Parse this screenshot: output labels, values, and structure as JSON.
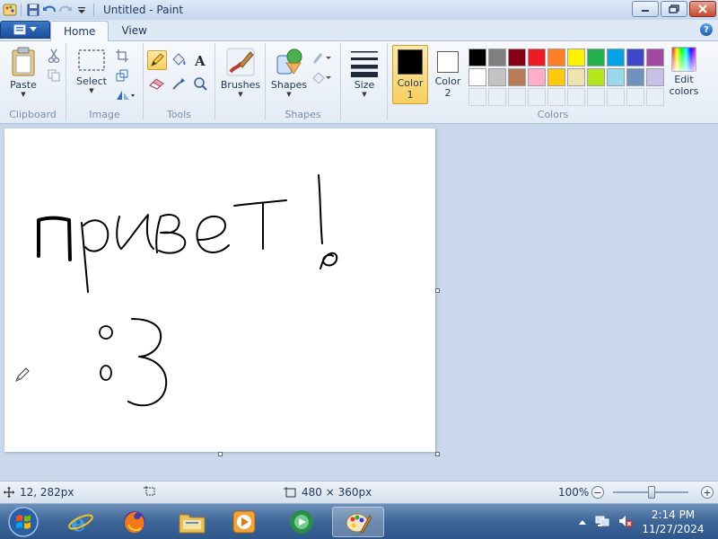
{
  "window": {
    "title": "Untitled - Paint"
  },
  "tabs": {
    "home": "Home",
    "view": "View"
  },
  "ribbon": {
    "clipboard": {
      "group_label": "Clipboard",
      "paste_label": "Paste"
    },
    "image": {
      "group_label": "Image",
      "select_label": "Select"
    },
    "tools": {
      "group_label": "Tools"
    },
    "brushes": {
      "label": "Brushes"
    },
    "shapes": {
      "group_label": "Shapes",
      "shapes_label": "Shapes"
    },
    "size": {
      "label": "Size"
    },
    "colors": {
      "group_label": "Colors",
      "color1_label": "Color",
      "color1_num": "1",
      "color2_label": "Color",
      "color2_num": "2",
      "color1_value": "#000000",
      "color2_value": "#ffffff",
      "edit_label_1": "Edit",
      "edit_label_2": "colors",
      "palette_row1": [
        "#000000",
        "#7f7f7f",
        "#880015",
        "#ed1c24",
        "#ff7f27",
        "#fff200",
        "#22b14c",
        "#00a2e8",
        "#3f48cc",
        "#a349a4"
      ],
      "palette_row2": [
        "#ffffff",
        "#c3c3c3",
        "#b97a57",
        "#ffaec9",
        "#ffc90e",
        "#efe4b0",
        "#b5e61d",
        "#99d9ea",
        "#7092be",
        "#c8bfe7"
      ]
    }
  },
  "canvas": {
    "handwritten_text": "привет!",
    "face_text": ":3"
  },
  "status": {
    "cursor_position": "12, 282px",
    "image_size": "480 × 360px",
    "zoom": "100%"
  },
  "taskbar": {
    "time": "2:14 PM",
    "date": "11/27/2024"
  }
}
